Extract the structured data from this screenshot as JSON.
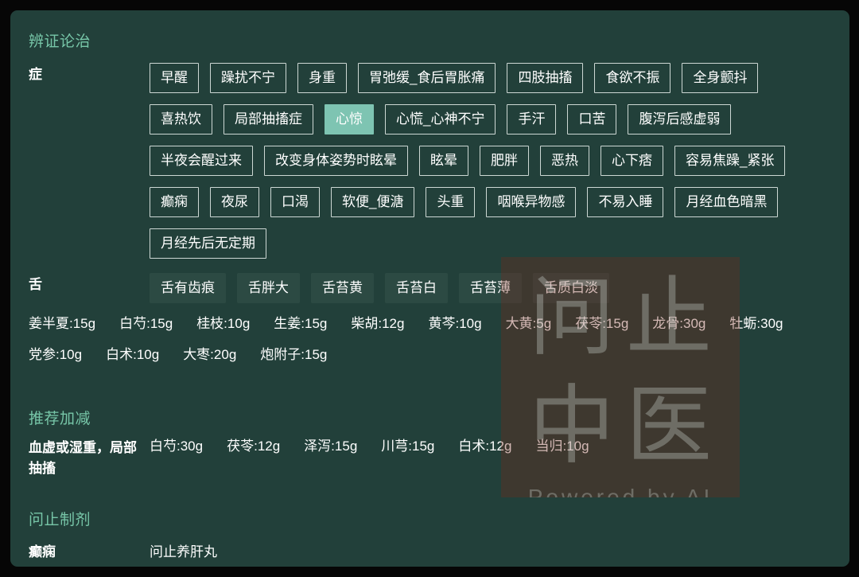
{
  "card": {
    "background_color": "#22403a",
    "page_background_color": "#060606",
    "accent_color": "#77c6a8",
    "selected_tag_color": "#7ec4b2"
  },
  "syndrome_section": {
    "title": "辨证论治",
    "symptom_row": {
      "label": "症",
      "tags": [
        {
          "text": "早醒",
          "selected": false
        },
        {
          "text": "躁扰不宁",
          "selected": false
        },
        {
          "text": "身重",
          "selected": false
        },
        {
          "text": "胃弛缓_食后胃胀痛",
          "selected": false
        },
        {
          "text": "四肢抽搐",
          "selected": false
        },
        {
          "text": "食欲不振",
          "selected": false
        },
        {
          "text": "全身颤抖",
          "selected": false
        },
        {
          "text": "喜热饮",
          "selected": false
        },
        {
          "text": "局部抽搐症",
          "selected": false
        },
        {
          "text": "心惊",
          "selected": true
        },
        {
          "text": "心慌_心神不宁",
          "selected": false
        },
        {
          "text": "手汗",
          "selected": false
        },
        {
          "text": "口苦",
          "selected": false
        },
        {
          "text": "腹泻后感虚弱",
          "selected": false
        },
        {
          "text": "半夜会醒过来",
          "selected": false
        },
        {
          "text": "改变身体姿势时眩晕",
          "selected": false
        },
        {
          "text": "眩晕",
          "selected": false
        },
        {
          "text": "肥胖",
          "selected": false
        },
        {
          "text": "恶热",
          "selected": false
        },
        {
          "text": "心下痞",
          "selected": false
        },
        {
          "text": "容易焦躁_紧张",
          "selected": false
        },
        {
          "text": "癫痫",
          "selected": false
        },
        {
          "text": "夜尿",
          "selected": false
        },
        {
          "text": "口渴",
          "selected": false
        },
        {
          "text": "软便_便溏",
          "selected": false
        },
        {
          "text": "头重",
          "selected": false
        },
        {
          "text": "咽喉异物感",
          "selected": false
        },
        {
          "text": "不易入睡",
          "selected": false
        },
        {
          "text": "月经血色暗黑",
          "selected": false
        },
        {
          "text": "月经先后无定期",
          "selected": false
        }
      ]
    },
    "tongue_row": {
      "label": "舌",
      "tags": [
        {
          "text": "舌有齿痕"
        },
        {
          "text": "舌胖大"
        },
        {
          "text": "舌苔黄"
        },
        {
          "text": "舌苔白"
        },
        {
          "text": "舌苔薄"
        },
        {
          "text": "舌质白淡"
        }
      ]
    },
    "prescription": [
      "姜半夏:15g",
      "白芍:15g",
      "桂枝:10g",
      "生姜:15g",
      "柴胡:12g",
      "黄芩:10g",
      "大黄:5g",
      "茯苓:15g",
      "龙骨:30g",
      "牡蛎:30g",
      "党参:10g",
      "白术:10g",
      "大枣:20g",
      "炮附子:15g"
    ]
  },
  "recommend_section": {
    "title": "推荐加减",
    "entries": [
      {
        "label": "血虚或湿重，局部抽搐",
        "herbs": [
          "白芍:30g",
          "茯苓:12g",
          "泽泻:15g",
          "川芎:15g",
          "白术:12g",
          "当归:10g"
        ]
      }
    ]
  },
  "preparation_section": {
    "title": "问止制剂",
    "entries": [
      {
        "label": "癫痫",
        "value": "问止养肝丸"
      }
    ]
  },
  "watermark": {
    "line1": "问止",
    "line2": "中医",
    "line3": "Powered by AI"
  }
}
